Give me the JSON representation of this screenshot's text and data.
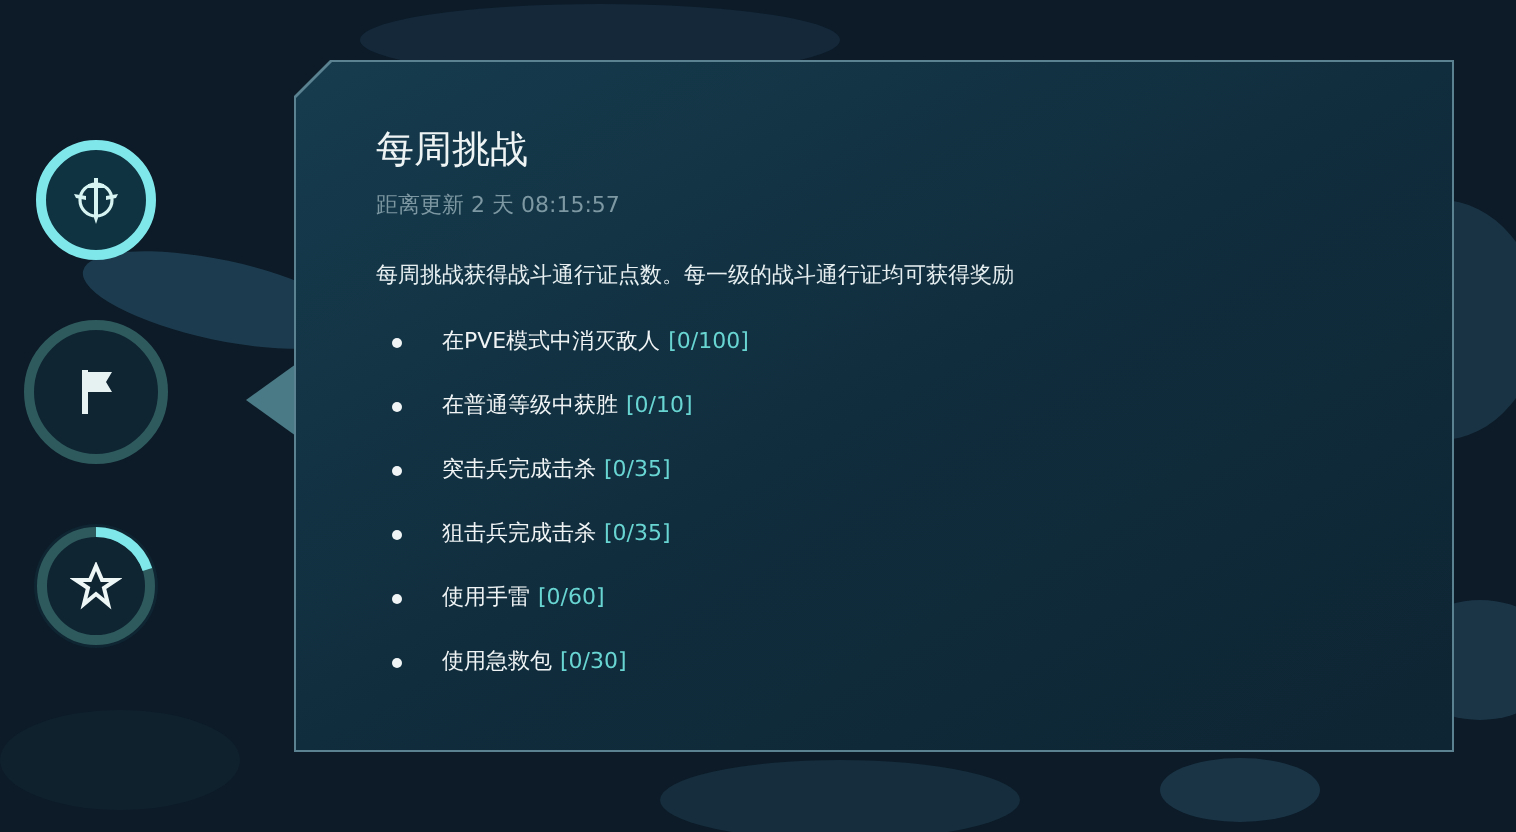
{
  "nav_buttons": [
    {
      "kind": "emblem",
      "selected": true
    },
    {
      "kind": "flag",
      "selected": false
    },
    {
      "kind": "star",
      "selected": false,
      "level": 0.2
    }
  ],
  "panel": {
    "title": "每周挑战",
    "countdown": "距离更新 2 天 08:15:57",
    "description": "每周挑战获得战斗通行证点数。每一级的战斗通行证均可获得奖励",
    "challenges": [
      {
        "text": "在PVE模式中消灭敌人",
        "progress": "[0/100]"
      },
      {
        "text": "在普通等级中获胜",
        "progress": "[0/10]"
      },
      {
        "text": "突击兵完成击杀",
        "progress": "[0/35]"
      },
      {
        "text": "狙击兵完成击杀",
        "progress": "[0/35]"
      },
      {
        "text": "使用手雷",
        "progress": "[0/60]"
      },
      {
        "text": "使用急救包",
        "progress": "[0/30]"
      }
    ]
  }
}
